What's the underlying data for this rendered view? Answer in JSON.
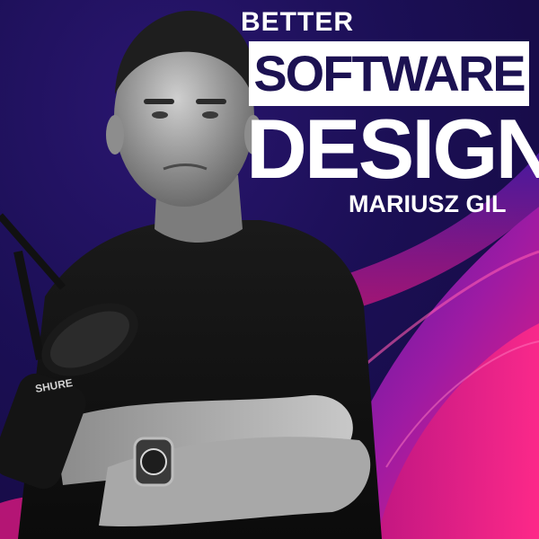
{
  "cover": {
    "title_line1": "BETTER",
    "title_line2": "SOFTWARE",
    "title_line3": "DESIGN",
    "author": "MARIUSZ GIL",
    "microphone_brand": "SHURE"
  },
  "colors": {
    "background_dark": "#1b0f55",
    "accent_magenta": "#e01a7a",
    "accent_purple": "#7a1fb0",
    "title_text": "#ffffff",
    "title_box_text": "#1c1252"
  }
}
